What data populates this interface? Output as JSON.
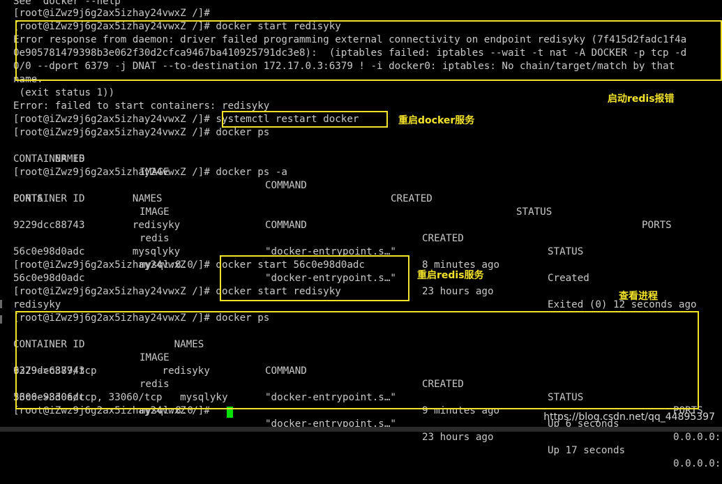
{
  "terminal": {
    "lines": [
      "See 'docker --help'",
      "[root@iZwz9j6g2ax5izhay24vwxZ /]#",
      "[root@iZwz9j6g2ax5izhay24vwxZ /]# docker start redisyky",
      "Error response from daemon: driver failed programming external connectivity on endpoint redisyky (7f415d2fadc1f4a",
      "0e905781479398b3e062f30d2cfca9467ba410925791dc3e8):  (iptables failed: iptables --wait -t nat -A DOCKER -p tcp -d",
      "0/0 --dport 6379 -j DNAT --to-destination 172.17.0.3:6379 ! -i docker0: iptables: No chain/target/match by that",
      "name.",
      " (exit status 1))",
      "Error: failed to start containers: redisyky",
      "[root@iZwz9j6g2ax5izhay24vwxZ /]# systemctl restart docker",
      "[root@iZwz9j6g2ax5izhay24vwxZ /]# docker ps",
      "",
      "       NAMES",
      "[root@iZwz9j6g2ax5izhay24vwxZ /]# docker ps -a",
      "",
      "PORTS               NAMES",
      "",
      "                    redisyky",
      "",
      "                    mysqlyky",
      "[root@iZwz9j6g2ax5izhay24vwxZ /]# docker start 56c0e98d0adc",
      "56c0e98d0adc",
      "[root@iZwz9j6g2ax5izhay24vwxZ /]# docker start redisyky",
      "redisyky",
      "[root@iZwz9j6g2ax5izhay24vwxZ /]# docker ps",
      "",
      "                           NAMES",
      "",
      "6379->6379/tcp           redisyky",
      "",
      "3306->3306/tcp, 33060/tcp   mysqlyky",
      "[root@iZwz9j6g2ax5izhay24vwxZ /]#"
    ],
    "ps_header_1": [
      "CONTAINER ID",
      "IMAGE",
      "COMMAND",
      "CREATED",
      "STATUS",
      "PORTS"
    ],
    "ps_a_header": [
      "CONTAINER ID",
      "IMAGE",
      "COMMAND",
      "CREATED",
      "STATUS"
    ],
    "ps_a_rows": [
      [
        "9229dcc88743",
        "redis",
        "\"docker-entrypoint.s…\"",
        "8 minutes ago",
        "Created"
      ],
      [
        "56c0e98d0adc",
        "mysql:8.0",
        "\"docker-entrypoint.s…\"",
        "23 hours ago",
        "Exited (0) 12 seconds ago"
      ]
    ],
    "ps_header_2": [
      "CONTAINER ID",
      "IMAGE",
      "COMMAND",
      "CREATED",
      "STATUS",
      "PORTS"
    ],
    "ps_rows_2": [
      [
        "9229dcc88743",
        "redis",
        "\"docker-entrypoint.s…\"",
        "9 minutes ago",
        "Up 6 seconds",
        "0.0.0.0:"
      ],
      [
        "56c0e98d0adc",
        "mysql:8.0",
        "\"docker-entrypoint.s…\"",
        "23 hours ago",
        "Up 17 seconds",
        "0.0.0.0:"
      ]
    ]
  },
  "annotations": {
    "start_error": "启动redis报错",
    "restart_docker": "重启docker服务",
    "restart_redis": "重启redis服务",
    "view_process": "查看进程"
  },
  "watermark": "https://blog.csdn.net/qq_44895397",
  "colors": {
    "background": "#000000",
    "text": "#c9c9c9",
    "highlight_box": "#f2e22a",
    "cursor": "#00e000"
  }
}
